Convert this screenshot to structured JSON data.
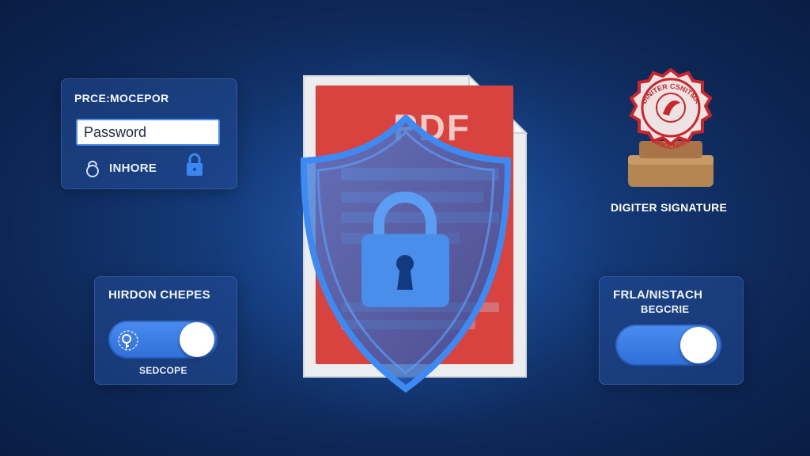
{
  "password_card": {
    "title": "PRCE:MOCEPOR",
    "password_value": "Password",
    "hint_label": "INHORE"
  },
  "left_toggle_card": {
    "title": "HIRDON CHEPES",
    "caption": "SEDCOPE",
    "toggle_state": "on"
  },
  "right_toggle_card": {
    "title_line1": "FRLA/NISTACH",
    "title_line2": "BEGCRIE",
    "toggle_state": "on"
  },
  "document": {
    "label": "PDF"
  },
  "signature": {
    "caption": "DIGITER SIGNATURE",
    "seal_text_top": "DINITER CSNITMR",
    "seal_text_bottom": "SRIGCNRIN"
  },
  "colors": {
    "background": "#0d2654",
    "accent": "#3a7be6",
    "document_red": "#d9433f",
    "seal_red": "#c8262c"
  },
  "icons": {
    "unlock": "unlock-icon",
    "lock": "lock-icon",
    "shield": "shield-icon",
    "padlock": "padlock-icon",
    "key": "key-icon"
  }
}
